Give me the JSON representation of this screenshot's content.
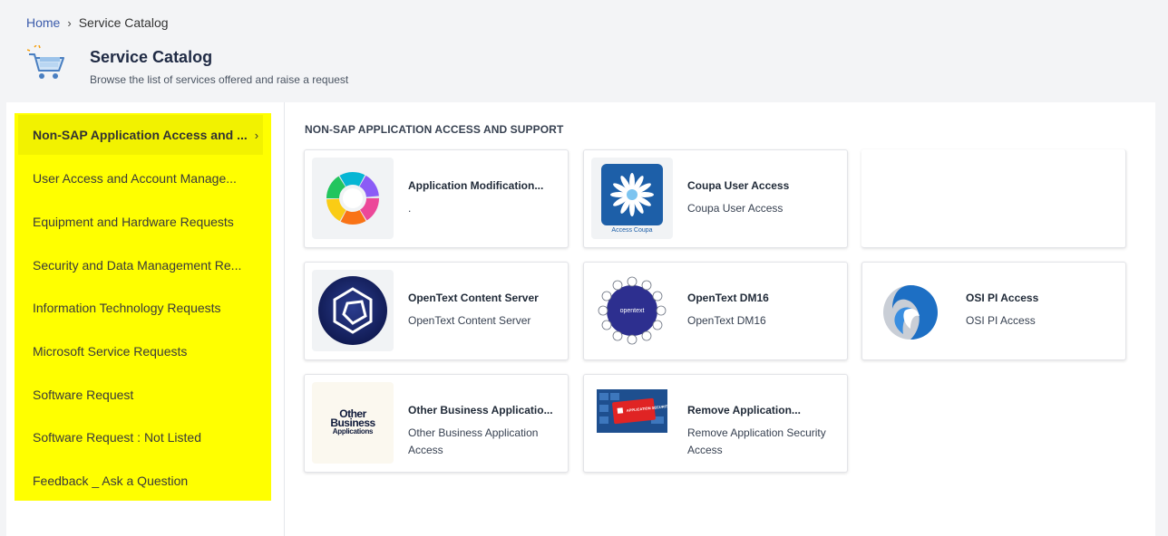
{
  "breadcrumb": {
    "home": "Home",
    "current": "Service Catalog"
  },
  "header": {
    "title": "Service Catalog",
    "subtitle": "Browse the list of services offered and raise a request"
  },
  "sidebar": {
    "highlight_color": "#ffff00",
    "items": [
      {
        "label": "Non-SAP Application Access and ...",
        "active": true
      },
      {
        "label": "User Access and Account Manage..."
      },
      {
        "label": "Equipment and Hardware Requests"
      },
      {
        "label": "Security and Data Management Re..."
      },
      {
        "label": "Information Technology Requests"
      },
      {
        "label": "Microsoft Service Requests"
      },
      {
        "label": "Software Request"
      },
      {
        "label": "Software Request : Not Listed"
      },
      {
        "label": "Feedback _ Ask a Question"
      }
    ]
  },
  "section": {
    "title": "NON-SAP APPLICATION ACCESS AND SUPPORT"
  },
  "cards": [
    {
      "title": "Application Modification...",
      "desc": ".",
      "icon": "cycle-diagram-icon"
    },
    {
      "title": "Coupa User Access",
      "desc": "Coupa User Access",
      "icon": "coupa-logo-icon",
      "logo_text": "Access Coupa"
    },
    {
      "title": "OpenText Content Server",
      "desc": "OpenText Content Server",
      "icon": "opentext-hexagon-icon"
    },
    {
      "title": "OpenText DM16",
      "desc": "OpenText DM16",
      "icon": "opentext-dm-icon",
      "logo_text": "opentext"
    },
    {
      "title": "OSI PI Access",
      "desc": "OSI PI Access",
      "icon": "osi-pi-logo-icon"
    },
    {
      "title": "Other Business Applicatio...",
      "desc": "Other Business Application Access",
      "icon": "other-business-apps-icon",
      "logo_text": [
        "Other",
        "Business",
        "Applications"
      ]
    },
    {
      "title": "Remove Application...",
      "desc": "Remove Application Security Access",
      "icon": "application-security-icon",
      "logo_text": "APPLICATION SECURITY"
    }
  ]
}
